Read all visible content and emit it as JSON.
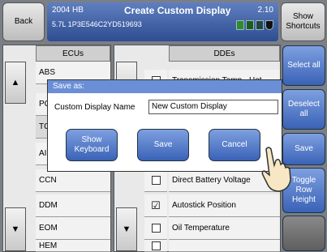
{
  "header": {
    "back_label": "Back",
    "model": "2004 HB",
    "title": "Create Custom Display",
    "version": "2.10",
    "vin": "5.7L  1P3E546C2YD519693",
    "shortcuts_label": "Show Shortcuts"
  },
  "ecus": {
    "header": "ECUs",
    "items": [
      "ABS",
      "PC",
      "TC",
      "AI",
      "CCN",
      "DDM",
      "EOM",
      "HEM"
    ]
  },
  "ddes": {
    "header": "DDEs",
    "items": [
      {
        "label": "Transmission Temp - Hot",
        "checked": false
      },
      {
        "label": "",
        "checked": false
      },
      {
        "label": "",
        "checked": false
      },
      {
        "label": "",
        "checked": false
      },
      {
        "label": "Direct Battery Voltage",
        "checked": false
      },
      {
        "label": "Autostick Position",
        "checked": true
      },
      {
        "label": "Oil Temperature",
        "checked": false
      },
      {
        "label": "",
        "checked": false
      }
    ]
  },
  "side_buttons": {
    "select_all": "Select all",
    "deselect_all": "Deselect all",
    "save": "Save",
    "toggle_row_height": "Toggle Row Height"
  },
  "dialog": {
    "title": "Save as:",
    "label": "Custom Display Name",
    "input_value": "New Custom Display",
    "keyboard_label": "Show Keyboard",
    "save_label": "Save",
    "cancel_label": "Cancel"
  },
  "checkmark": "☑",
  "arrows": {
    "up": "▲",
    "down": "▼"
  }
}
